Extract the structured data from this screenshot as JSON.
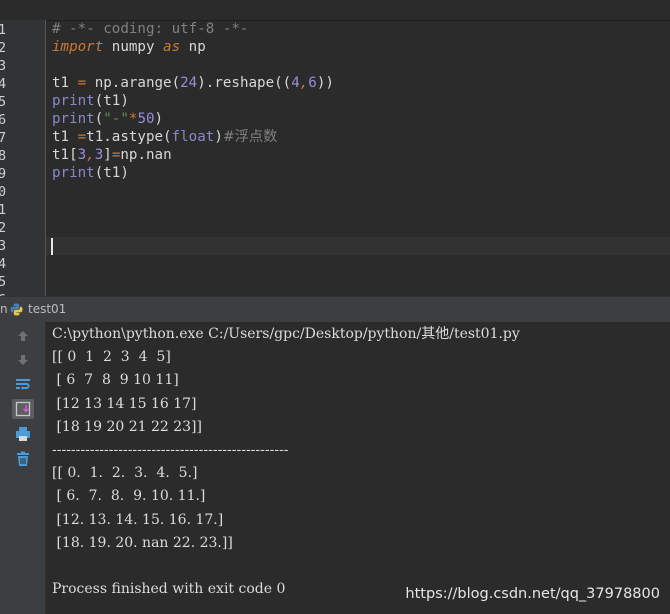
{
  "editor": {
    "line_numbers": [
      "1",
      "2",
      "3",
      "4",
      "5",
      "6",
      "7",
      "8",
      "9",
      "0",
      "1",
      "2",
      "3",
      "4",
      "5",
      "6"
    ],
    "lines": [
      {
        "segments": [
          {
            "t": "# -*- coding: utf-8 -*-",
            "c": "cm"
          }
        ]
      },
      {
        "segments": [
          {
            "t": "import",
            "c": "kw"
          },
          {
            "t": " numpy ",
            "c": ""
          },
          {
            "t": "as",
            "c": "kw"
          },
          {
            "t": " np",
            "c": ""
          }
        ]
      },
      {
        "segments": []
      },
      {
        "segments": [
          {
            "t": "t1 ",
            "c": ""
          },
          {
            "t": "=",
            "c": "kw"
          },
          {
            "t": " np.arange(",
            "c": ""
          },
          {
            "t": "24",
            "c": "num"
          },
          {
            "t": ").reshape((",
            "c": ""
          },
          {
            "t": "4",
            "c": "num"
          },
          {
            "t": ",",
            "c": "kw"
          },
          {
            "t": "6",
            "c": "num"
          },
          {
            "t": "))",
            "c": ""
          }
        ]
      },
      {
        "segments": [
          {
            "t": "print",
            "c": "fn"
          },
          {
            "t": "(t1)",
            "c": ""
          }
        ]
      },
      {
        "segments": [
          {
            "t": "print",
            "c": "fn"
          },
          {
            "t": "(",
            "c": ""
          },
          {
            "t": "\"-\"",
            "c": "str"
          },
          {
            "t": "*",
            "c": "kw"
          },
          {
            "t": "50",
            "c": "num"
          },
          {
            "t": ")",
            "c": ""
          }
        ]
      },
      {
        "segments": [
          {
            "t": "t1 ",
            "c": ""
          },
          {
            "t": "=",
            "c": "kw"
          },
          {
            "t": "t1.astype(",
            "c": ""
          },
          {
            "t": "float",
            "c": "fn"
          },
          {
            "t": ")",
            "c": ""
          },
          {
            "t": "#浮点数",
            "c": "cm zh"
          }
        ]
      },
      {
        "segments": [
          {
            "t": "t1[",
            "c": ""
          },
          {
            "t": "3",
            "c": "num"
          },
          {
            "t": ",",
            "c": "kw"
          },
          {
            "t": "3",
            "c": "num"
          },
          {
            "t": "]",
            "c": ""
          },
          {
            "t": "=",
            "c": "kw"
          },
          {
            "t": "np.nan",
            "c": ""
          }
        ]
      },
      {
        "segments": [
          {
            "t": "print",
            "c": "fn"
          },
          {
            "t": "(t1)",
            "c": ""
          }
        ]
      }
    ]
  },
  "run_tab": {
    "prefix": "n",
    "label": "test01"
  },
  "console": {
    "lines": [
      "C:\\python\\python.exe C:/Users/gpc/Desktop/python/其他/test01.py",
      "[[ 0  1  2  3  4  5]",
      " [ 6  7  8  9 10 11]",
      " [12 13 14 15 16 17]",
      " [18 19 20 21 22 23]]",
      "--------------------------------------------------",
      "[[ 0.  1.  2.  3.  4.  5.]",
      " [ 6.  7.  8.  9. 10. 11.]",
      " [12. 13. 14. 15. 16. 17.]",
      " [18. 19. 20. nan 22. 23.]]",
      "",
      "Process finished with exit code 0"
    ]
  },
  "toolbar_icons": [
    "up-arrow-icon",
    "down-arrow-icon",
    "soft-wrap-icon",
    "scroll-to-end-icon",
    "print-icon",
    "trash-icon"
  ],
  "watermark": "https://blog.csdn.net/qq_37978800",
  "colors": {
    "editor_bg": "#2b2b2b",
    "gutter_bg": "#313335",
    "keyword": "#cc7832",
    "comment": "#808080",
    "number": "#9c8cd8",
    "string": "#6a8759",
    "builtin": "#8888c6",
    "toolwindow_bg": "#3c3f41"
  }
}
